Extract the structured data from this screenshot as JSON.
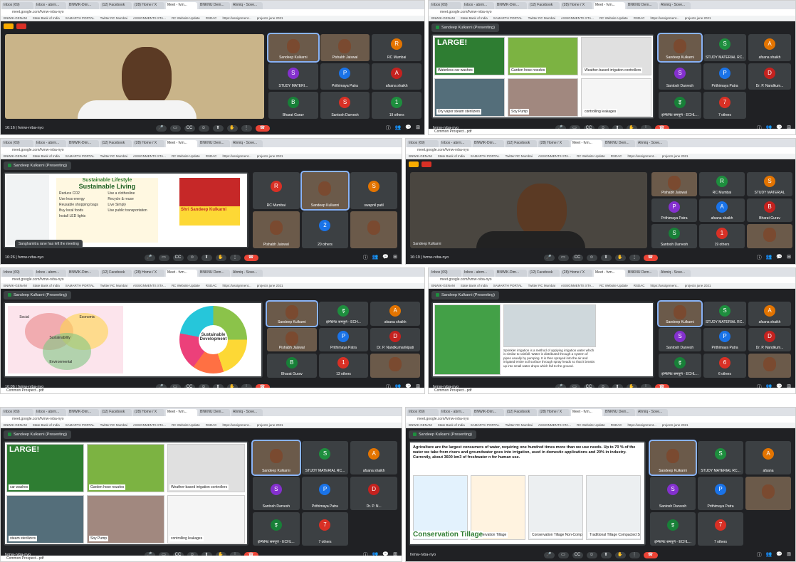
{
  "browser": {
    "tabs": [
      "Inbox (69)",
      "Inbox - abrm...",
      "BNWIK-Dim...",
      "(12) Facebook",
      "(28) Home / X",
      "Meet - fvm...",
      "BNKNU Dem...",
      "Ahmiq - Sove..."
    ],
    "address": "meet.google.com/fvmw-rvba-nyo",
    "bookmarks": [
      "BNWIK-GENAM",
      "State Bank of India",
      "SAMARTH PORTAL",
      "Twitter RC Mumbai",
      "ASSIGNMENTS STA...",
      "RC Website Update",
      "RSDAC",
      "https://assignment...",
      "projects june 2021"
    ]
  },
  "meeting": {
    "code": "fvmw-rvba-nyo",
    "presenter_label": "Sandeep Kulkarni (Presenting)",
    "leave_icon": "phone-hangup-icon"
  },
  "shots": [
    {
      "time": "16:16",
      "main_name": "",
      "participants": [
        "Sandeep Kulkarni",
        "Pishabh Jaiswal",
        "RC Mumbai",
        "STUDY MATERI...",
        "Prithimaya Patra",
        "afsana shaikh",
        "Bharat Gurav",
        "Santosh Darvesh",
        "19 others"
      ]
    },
    {
      "time": "",
      "slide_labels": [
        "LARGE!",
        "Waterless car washes",
        "Garden hose nozzles",
        "Weather-based irrigation controllers",
        "Dry vapor steam sterilizers",
        "Soy Pump",
        "controlling leakages"
      ],
      "participants": [
        "Sandeep Kulkarni",
        "STUDY MATERIAL RC...",
        "afsana shaikh",
        "Santosh Darvesh",
        "Prithimaya Patra",
        "Dr. P. Nandkum...",
        "इन्फिनिट समपूर्ण - ECHL...",
        "7 others"
      ]
    },
    {
      "time": "16:26",
      "slide_title": "Sustainable Lifestyle",
      "slide_subtitle": "Sustainable Living",
      "slide_items": [
        "Reduce CO2",
        "Use a clothesline",
        "Use less energy",
        "Recycle & reuse",
        "Reusable shopping bags",
        "Live Simply",
        "Buy local foods",
        "Use public transportation",
        "Install LED lights"
      ],
      "speaker_caption": "Shri Sandeep Kulkarni",
      "toast": "Sanghamitra rane has left the meeting",
      "participants": [
        "RC Mumbai",
        "Sandeep Kulkarni",
        "swapnil patil",
        "Pishabh Jaiswal",
        "20 others",
        ""
      ]
    },
    {
      "time": "16:19",
      "main_name": "Sandeep Kulkarni",
      "participants": [
        "Pishabh Jaiswal",
        "RC Mumbai",
        "STUDY MATERIAL",
        "Prithimaya Patra",
        "afsana shaikh",
        "Bharat Gurav",
        "Santosh Darvesh",
        "19 others",
        ""
      ]
    },
    {
      "time": "16:06",
      "slide_left_labels": [
        "Social",
        "Economic",
        "Sustainability",
        "Environmental"
      ],
      "slide_right_label": "Sustainable Development",
      "participants": [
        "Sandeep Kulkarni",
        "इन्फिनिट समपूर्ण - ECH...",
        "afsana shaikh",
        "Pishabh Jaiswal",
        "Prithimaya Patra",
        "Dr. P. Nandkumarikipati",
        "Bharat Gurav",
        "13 others",
        ""
      ]
    },
    {
      "time": "",
      "slide_caption": "Sprinkler irrigation is a method of applying irrigation water which is similar to rainfall. Water is distributed through a system of pipes usually by pumping. It is then sprayed into the air and irrigated entire soil surface through spray heads so that it breaks up into small water drops which fall to the ground.",
      "participants": [
        "Sandeep Kulkarni",
        "STUDY MATERIAL RC...",
        "afsana shaikh",
        "Santosh Darvesh",
        "Prithimaya Patra",
        "Dr. P. Nandkum...",
        "इन्फिनिट समपूर्ण - ECHL...",
        "6 others",
        ""
      ]
    },
    {
      "time": "",
      "slide_labels": [
        "LARGE!",
        "car washes",
        "Garden hose nozzles",
        "Weather-based irrigation controllers",
        "steam sterilizers",
        "Soy Pump",
        "controlling leakages"
      ],
      "participants": [
        "Sandeep Kulkarni",
        "STUDY MATERIAL RC...",
        "afsana shaikh",
        "Santosh Darvesh",
        "Prithimaya Patra",
        "Dr. P. N...",
        "इन्फिनिट समपूर्ण - ECHL...",
        "7 others"
      ]
    },
    {
      "time": "",
      "slide_text": "Agriculture are the largest consumers of water, requiring one hundred times more than we use needs. Up to 70 % of the water we take from rivers and groundwater goes into irrigation, used in domestic applications and 20% in industry. Currently, about 3600 km3 of freshwater n for human use.",
      "slide_labels": [
        "Conventional tillage",
        "Conservation Tillage",
        "Conservation Tillage Non-Compacted Soil",
        "Traditional Tillage Compacted Soil",
        "Conservation Tillage"
      ],
      "participants": [
        "Sandeep Kulkarni",
        "STUDY MATERIAL RC...",
        "afsana",
        "Santosh Darvesh",
        "Prithimaya Patra",
        "",
        "इन्फिनिट समपूर्ण - ECHL...",
        "7 others"
      ]
    }
  ],
  "download": "Common Prospect...pdf",
  "colors": {
    "meet_bg": "#202124",
    "tile": "#3c4043",
    "leave": "#ea4335",
    "accent": "#8ab4f8"
  }
}
